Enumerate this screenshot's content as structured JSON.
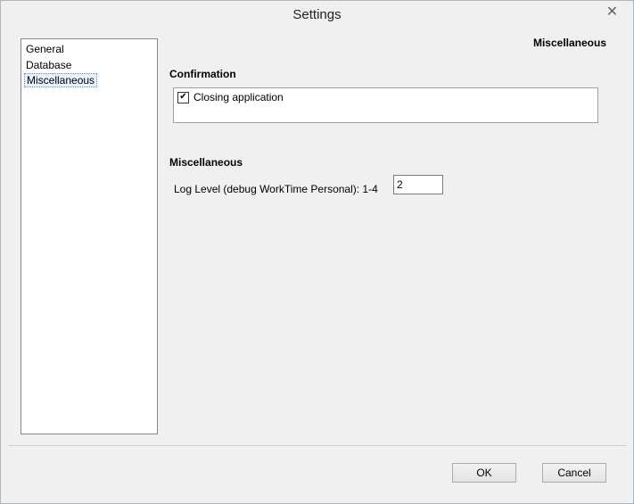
{
  "window": {
    "title": "Settings"
  },
  "nav": {
    "items": [
      {
        "label": "General"
      },
      {
        "label": "Database"
      },
      {
        "label": "Miscellaneous"
      }
    ],
    "selected": "Miscellaneous"
  },
  "page": {
    "header": "Miscellaneous"
  },
  "confirmation": {
    "title": "Confirmation",
    "closing_app": {
      "label": "Closing application",
      "checked": true
    }
  },
  "misc": {
    "title": "Miscellaneous",
    "log_level_label": "Log Level (debug WorkTime Personal): 1-4",
    "log_level_value": "2"
  },
  "buttons": {
    "ok": "OK",
    "cancel": "Cancel"
  },
  "icons": {
    "close": "close-icon",
    "check": "checkmark-icon"
  }
}
